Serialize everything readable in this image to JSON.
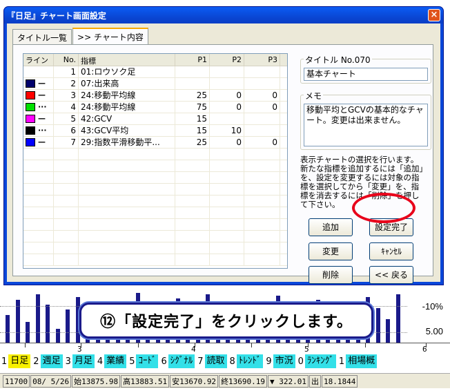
{
  "background": {
    "axis_labels": [
      "-10%",
      "5.00"
    ],
    "ruler_numbers": [
      "3",
      "4",
      "5",
      "6"
    ],
    "nav_items": [
      {
        "num": "1",
        "label": "日足",
        "active": true
      },
      {
        "num": "2",
        "label": "週足",
        "active": false
      },
      {
        "num": "3",
        "label": "月足",
        "active": false
      },
      {
        "num": "4",
        "label": "業績",
        "active": false
      },
      {
        "num": "5",
        "label": "ｺｰﾄﾞ",
        "active": false
      },
      {
        "num": "6",
        "label": "ｼｸﾞﾅﾙ",
        "active": false
      },
      {
        "num": "7",
        "label": "読取",
        "active": false
      },
      {
        "num": "8",
        "label": "ﾄﾚﾝﾄﾞ",
        "active": false
      },
      {
        "num": "9",
        "label": "市況",
        "active": false
      },
      {
        "num": "0",
        "label": "ﾗﾝｷﾝｸﾞ",
        "active": false
      },
      {
        "num": "1",
        "label": "相場概",
        "active": false
      }
    ],
    "status": [
      "11700",
      "08/ 5/26",
      "始13875.98",
      "高13883.51",
      "安13670.92",
      "終13690.19",
      "▼ 322.01",
      "出",
      "18.1844"
    ]
  },
  "dialog": {
    "title": "『日足』チャート画面設定",
    "close_label": "×",
    "tabs": [
      "タイトル一覧",
      ">> チャート内容"
    ],
    "active_tab": 1,
    "columns": [
      "ライン",
      "No.",
      "指標",
      "P1",
      "P2",
      "P3"
    ],
    "rows": [
      {
        "color": "",
        "style": "",
        "no": "1",
        "name": "01:ロウソク足",
        "p1": "",
        "p2": "",
        "p3": ""
      },
      {
        "color": "#00006b",
        "style": "—",
        "no": "2",
        "name": "07:出来高",
        "p1": "",
        "p2": "",
        "p3": ""
      },
      {
        "color": "#ff0000",
        "style": "—",
        "no": "3",
        "name": "24:移動平均線",
        "p1": "25",
        "p2": "0",
        "p3": "0"
      },
      {
        "color": "#00e000",
        "style": "···",
        "no": "4",
        "name": "24:移動平均線",
        "p1": "75",
        "p2": "0",
        "p3": "0"
      },
      {
        "color": "#ff00ff",
        "style": "—",
        "no": "5",
        "name": "42:GCV",
        "p1": "15",
        "p2": "",
        "p3": ""
      },
      {
        "color": "#000000",
        "style": "···",
        "no": "6",
        "name": "43:GCV平均",
        "p1": "15",
        "p2": "10",
        "p3": ""
      },
      {
        "color": "#0000ff",
        "style": "—",
        "no": "7",
        "name": "29:指数平滑移動平...",
        "p1": "25",
        "p2": "0",
        "p3": "0"
      }
    ],
    "title_group_label": "タイトル No.070",
    "title_value": "基本チャート",
    "memo_label": "メモ",
    "memo_value": "移動平均とGCVの基本的なチャート。変更は出来ません。",
    "description": "表示チャートの選択を行います。新たな指標を追加するには「追加」を、設定を変更するには対象の指標を選択してから「変更」を、指標を消去するには「削除」を押して下さい。",
    "buttons": {
      "add": "追加",
      "done": "設定完了",
      "change": "変更",
      "cancel": "ｷｬﾝｾﾙ",
      "delete": "削除",
      "back": "<< 戻る"
    }
  },
  "callout": "⑫「設定完了」をクリックします。"
}
